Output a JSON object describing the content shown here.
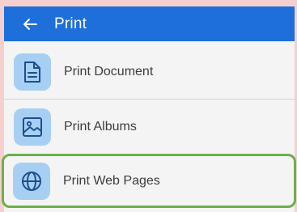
{
  "appbar": {
    "title": "Print",
    "back_icon": "arrow-left-icon",
    "color": "#1e6fd9"
  },
  "items": [
    {
      "label": "Print Document",
      "icon": "document-icon"
    },
    {
      "label": "Print Albums",
      "icon": "image-icon"
    },
    {
      "label": "Print Web Pages",
      "icon": "globe-icon",
      "selected": true
    }
  ],
  "colors": {
    "background": "#f6cfcf",
    "tile": "#a7cff4",
    "icon": "#1c4f8c",
    "selection_border": "#6db04a"
  }
}
